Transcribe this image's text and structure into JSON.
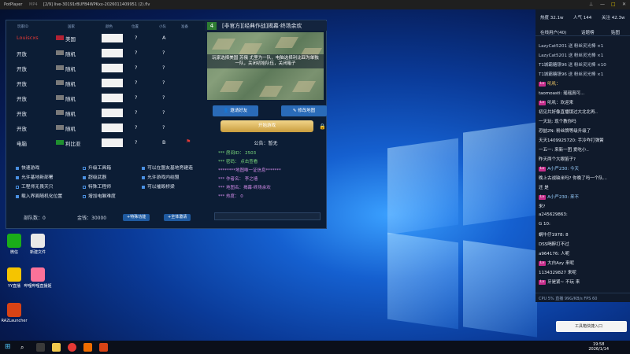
{
  "titlebar": {
    "app": "PotPlayer",
    "mode": "MP4",
    "file": "[2/9] live-30191rBUFB4WPKxx-2026011409951 (2).flv"
  },
  "room": {
    "headers": [
      "玩家ID",
      "国家",
      "颜色",
      "位置",
      "小队",
      "准备"
    ],
    "players": [
      {
        "name": "Louiscxs",
        "race": "美国",
        "pos": "?",
        "team": "A",
        "host": "",
        "flag_color": "#b22234",
        "name_color": "#e53935"
      },
      {
        "name": "开放",
        "race": "随机",
        "pos": "?",
        "team": "?",
        "host": "",
        "flag_color": "#7a7a7a",
        "name_color": "#e6ecf5"
      },
      {
        "name": "开放",
        "race": "随机",
        "pos": "?",
        "team": "?",
        "host": "",
        "flag_color": "#7a7a7a",
        "name_color": "#e6ecf5"
      },
      {
        "name": "开放",
        "race": "随机",
        "pos": "?",
        "team": "?",
        "host": "",
        "flag_color": "#7a7a7a",
        "name_color": "#e6ecf5"
      },
      {
        "name": "开放",
        "race": "随机",
        "pos": "?",
        "team": "?",
        "host": "",
        "flag_color": "#7a7a7a",
        "name_color": "#e6ecf5"
      },
      {
        "name": "开放",
        "race": "随机",
        "pos": "?",
        "team": "?",
        "host": "",
        "flag_color": "#7a7a7a",
        "name_color": "#e6ecf5"
      },
      {
        "name": "开放",
        "race": "随机",
        "pos": "?",
        "team": "?",
        "host": "",
        "flag_color": "#7a7a7a",
        "name_color": "#e6ecf5"
      },
      {
        "name": "电脑",
        "race": "利比亚",
        "pos": "?",
        "team": "B",
        "host": "⚑",
        "flag_color": "#1f8f2f",
        "name_color": "#e6ecf5"
      }
    ],
    "options": [
      {
        "label": "快速游戏",
        "on": true
      },
      {
        "label": "允许基地新部署",
        "on": true
      },
      {
        "label": "工程师无畏天只",
        "on": false
      },
      {
        "label": "载入界面随机化位置",
        "on": true
      },
      {
        "label": "升级工具箱",
        "on": false
      },
      {
        "label": "超级武器",
        "on": true
      },
      {
        "label": "特殊工程师",
        "on": false
      },
      {
        "label": "增加电脑难度",
        "on": false
      },
      {
        "label": "可以在盟友基地旁建造",
        "on": true
      },
      {
        "label": "允许游戏内结盟",
        "on": true
      },
      {
        "label": "可以摧毁桥梁",
        "on": true
      }
    ],
    "bottom": {
      "team_count_label": "部队数：",
      "team_count": "0",
      "money_label": "金钱：",
      "money": "30000",
      "special_btn": "+特殊功能",
      "invite_all_btn": "+全体邀请"
    },
    "map": {
      "number": "4",
      "title": "[非官方][经典作战]揭幕·终场余欢",
      "desc": "玩家选择美国 苏俄 尤里为一队，电脑选择利比亚为单独一队，关闭初始队伍，关闭箱子",
      "invite_btn": "邀请好友",
      "change_map_btn": "修改地图",
      "start_btn": "开始游戏",
      "notice": "公告：暂无",
      "info": [
        {
          "text": "*** 房间ID： 2503",
          "color": "#7ddc7d"
        },
        {
          "text": "*** 密码： 点击查看",
          "color": "#7ddc7d"
        },
        {
          "text": "********地图唯一证信息*******",
          "color": "#d08ae6"
        },
        {
          "text": "*** 作者名： 李之墙",
          "color": "#d08ae6"
        },
        {
          "text": "*** 地图名：揭幕·终场余欢",
          "color": "#d08ae6"
        },
        {
          "text": "*** 热度： 0",
          "color": "#d08ae6"
        }
      ]
    }
  },
  "desktop_icons": [
    {
      "label": "微信",
      "color": "#1aad19"
    },
    {
      "label": "新建文件",
      "color": "#e8e8e8"
    },
    {
      "label": "YY直播",
      "color": "#f5c400"
    },
    {
      "label": "哔哩哔哩直播姬",
      "color": "#fb7299"
    },
    {
      "label": "RA2Launcher",
      "color": "#d84315"
    }
  ],
  "live": {
    "hot": "热度 32.1w",
    "people": "人气 144",
    "likes": "关注 42.3w",
    "tabs": [
      "在线用户(40)",
      "话题榜",
      "贴图"
    ],
    "chat": [
      {
        "badge": "",
        "text": "LazyCat5201 送 粉丝灵光棒 ×1",
        "color": "#c4cfe0"
      },
      {
        "badge": "",
        "text": "LazyCat5201 送 粉丝灵光棒 ×1",
        "color": "#c4cfe0"
      },
      {
        "badge": "",
        "text": "T1城霸糖镣96 送 粉丝灵光棒 ×10",
        "color": "#c4cfe0"
      },
      {
        "badge": "",
        "text": "T1城霸糖镣96 送 粉丝灵光棒 ×1",
        "color": "#c4cfe0"
      },
      {
        "badge": "Lv",
        "text": "叽叽：",
        "color": "#ffd36b"
      },
      {
        "badge": "",
        "text": "taomoasti: 瑶瑶真可...",
        "color": "#e6ecf5"
      },
      {
        "badge": "Lv",
        "text": "叽叽：欢迎来",
        "color": "#e6ecf5"
      },
      {
        "badge": "",
        "text": "初见共好像直播镜过大北北再..",
        "color": "#e6ecf5"
      },
      {
        "badge": "",
        "text": "一天玩: 现个教你吗",
        "color": "#e6ecf5"
      },
      {
        "badge": "",
        "text": "恐喆2N: 粉丝牌等级升级了",
        "color": "#e6ecf5"
      },
      {
        "badge": "",
        "text": "天天1409925720: 手冷咋打弹簧",
        "color": "#e6ecf5"
      },
      {
        "badge": "",
        "text": "一五一: 来新一团 爱吃小..",
        "color": "#e6ecf5"
      },
      {
        "badge": "",
        "text": "昨天两个大眼笛子?",
        "color": "#e6ecf5"
      },
      {
        "badge": "Lv",
        "text": "A小严230: 今天",
        "color": "#9ad0ff"
      },
      {
        "badge": "",
        "text": "晚上古战缺米吗? 你晚了吗一个队...",
        "color": "#e6ecf5"
      },
      {
        "badge": "",
        "text": "还 是",
        "color": "#e6ecf5"
      },
      {
        "badge": "Lv",
        "text": "A小严230: 来不",
        "color": "#9ad0ff"
      },
      {
        "badge": "",
        "text": "来?",
        "color": "#e6ecf5"
      },
      {
        "badge": "",
        "text": "a245629863:",
        "color": "#e6ecf5"
      },
      {
        "badge": "",
        "text": "G 10:",
        "color": "#e6ecf5"
      },
      {
        "badge": "",
        "text": "蜗牛仔1978: 8",
        "color": "#e6ecf5"
      },
      {
        "badge": "",
        "text": "DSS喝醉打不过",
        "color": "#e6ecf5"
      },
      {
        "badge": "",
        "text": "a964176: 人呢",
        "color": "#e6ecf5"
      },
      {
        "badge": "Lv",
        "text": "大白Azy 来呢",
        "color": "#e6ecf5"
      },
      {
        "badge": "",
        "text": "1134329827 来呢",
        "color": "#e6ecf5"
      },
      {
        "badge": "Lv",
        "text": "牙是紧~ 不玩 来",
        "color": "#e6ecf5"
      }
    ],
    "footer": "CPU 5%   直播 99G/KB/s   FPS 60"
  },
  "toast": "工具箱快捷入口",
  "taskbar": {
    "time": "19:58",
    "date": "2026/1/14"
  }
}
